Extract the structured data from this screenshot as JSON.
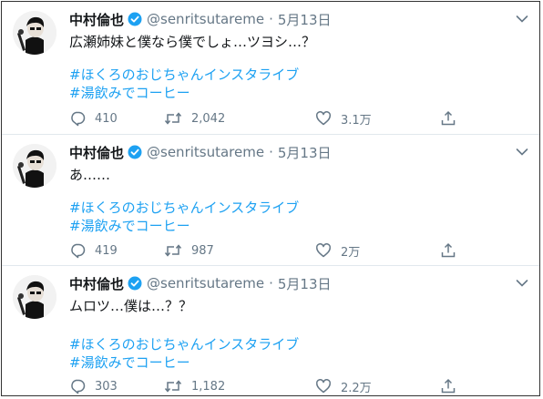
{
  "tweets": [
    {
      "name": "中村倫也",
      "handle": "@senritsutareme",
      "separator": "·",
      "date": "5月13日",
      "text": "広瀬姉妹と僕なら僕でしょ…ツヨシ…？",
      "hashtags": [
        "#ほくろのおじちゃんインスタライブ",
        "#湯飲みでコーヒー"
      ],
      "replies": "410",
      "retweets": "2,042",
      "likes": "3.1万"
    },
    {
      "name": "中村倫也",
      "handle": "@senritsutareme",
      "separator": "·",
      "date": "5月13日",
      "text": "あ……",
      "hashtags": [
        "#ほくろのおじちゃんインスタライブ",
        "#湯飲みでコーヒー"
      ],
      "replies": "419",
      "retweets": "987",
      "likes": "2万"
    },
    {
      "name": "中村倫也",
      "handle": "@senritsutareme",
      "separator": "·",
      "date": "5月13日",
      "text": "ムロツ…僕は…？？",
      "hashtags": [
        "#ほくろのおじちゃんインスタライブ",
        "#湯飲みでコーヒー"
      ],
      "replies": "303",
      "retweets": "1,182",
      "likes": "2.2万"
    }
  ],
  "icons": {
    "verified": "verified-badge-icon",
    "caret": "chevron-down-icon",
    "reply": "reply-icon",
    "retweet": "retweet-icon",
    "like": "heart-icon",
    "share": "share-icon"
  },
  "colors": {
    "text": "#14171a",
    "muted": "#657786",
    "link": "#1da1f2",
    "divider": "#e1e8ed"
  }
}
